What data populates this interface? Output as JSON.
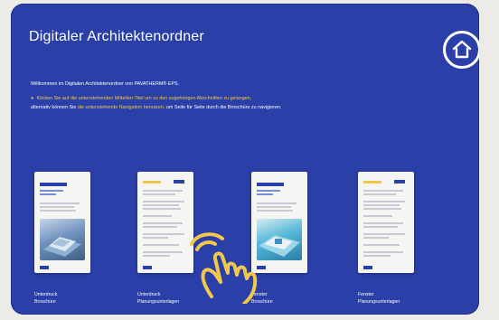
{
  "header": {
    "title": "Digitaler Architektenordner",
    "home_icon": "home-icon"
  },
  "intro": {
    "welcome": "Willkommen im Digitalen Architektenordner von PAVATHERM® EPS.",
    "note_part1": "Klicken Sie auf die untenstehenden Mitteilen-Titel um zu den zugehörigen Abschnitten zu gelangen,",
    "note_part2": "alternativ können Sie",
    "note_highlight1": "die untenstehende",
    "note_highlight2": "Navigation benutzen,",
    "note_part3": "um Seite für Seite durch die Broschüre zu navigieren.",
    "note_part4": "zu navigieren."
  },
  "documents": [
    {
      "line1": "Unterdruck",
      "line2": "Broschüre",
      "kind": "brochure",
      "photo": "#5d86b8"
    },
    {
      "line1": "Unterdruck",
      "line2": "Planungsunterlagen",
      "kind": "planning"
    },
    {
      "line1": "Fenster",
      "line2": "Broschüre",
      "kind": "brochure",
      "photo": "#3fa7c9"
    },
    {
      "line1": "Fenster",
      "line2": "Planungsunterlagen",
      "kind": "planning"
    }
  ],
  "colors": {
    "background": "#2a3fa8",
    "accent": "#f2c84b",
    "text": "#ffffff"
  },
  "overlay": {
    "icon": "tap-hand-icon"
  }
}
